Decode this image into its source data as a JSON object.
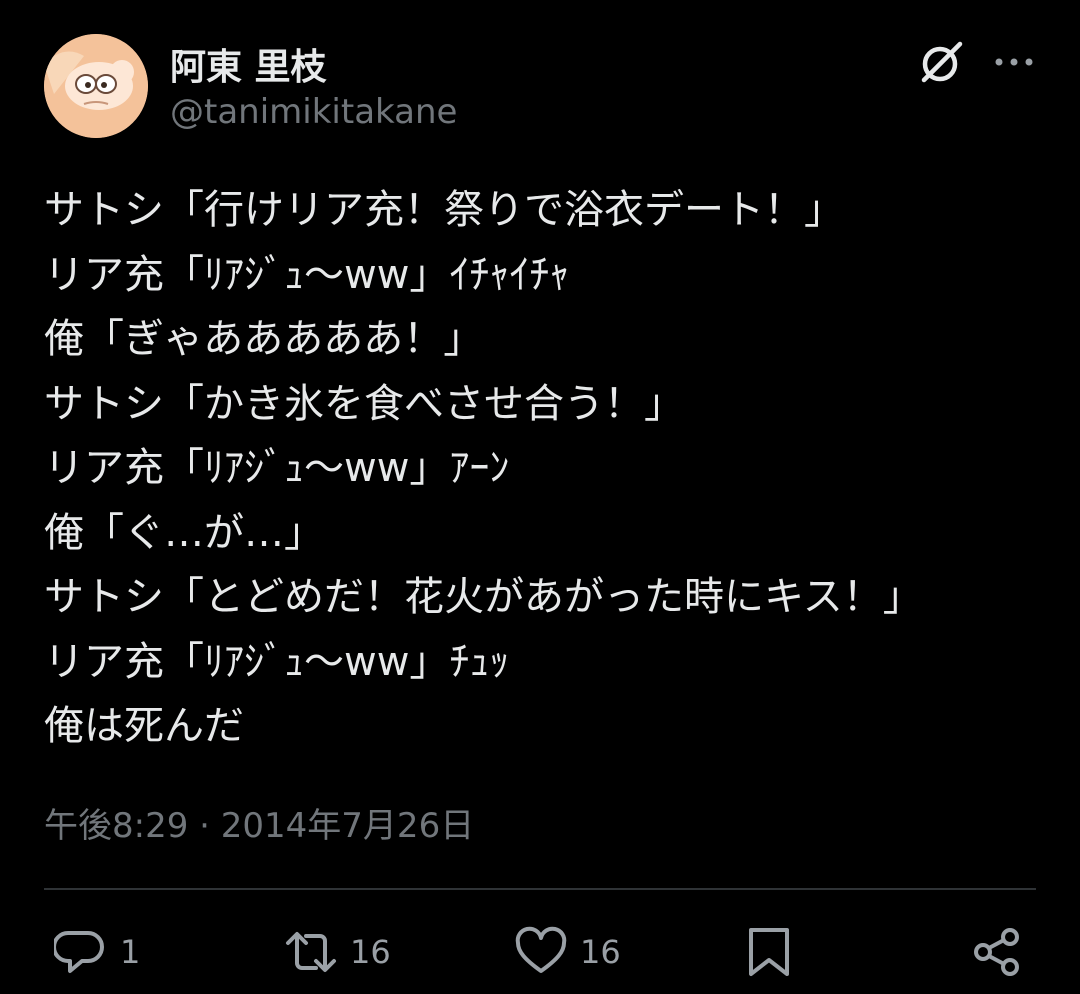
{
  "user": {
    "display_name": "阿東 里枝",
    "handle": "@tanimikitakane"
  },
  "header": {
    "grok_icon": "grok-icon",
    "more_icon": "more-dots-icon"
  },
  "tweet": {
    "lines": [
      "サトシ「行けリア充！祭りで浴衣デート！」",
      "リア充「ﾘｱｼﾞｭ〜ww」ｲﾁｬｲﾁｬ",
      "俺「ぎゃあああああ！」",
      "サトシ「かき氷を食べさせ合う！」",
      "リア充「ﾘｱｼﾞｭ〜ww」ｱｰﾝ",
      "俺「ぐ…が…」",
      "サトシ「とどめだ！花火があがった時にキス！」",
      "リア充「ﾘｱｼﾞｭ〜ww」ﾁｭｯ",
      "俺は死んだ"
    ],
    "timestamp": "午後8:29 · 2014年7月26日"
  },
  "actions": {
    "reply": {
      "icon": "reply-icon",
      "count": "1"
    },
    "retweet": {
      "icon": "retweet-icon",
      "count": "16"
    },
    "like": {
      "icon": "heart-icon",
      "count": "16"
    },
    "bookmark": {
      "icon": "bookmark-icon"
    },
    "share": {
      "icon": "share-icon"
    }
  },
  "colors": {
    "background": "#000000",
    "text_primary": "#e7e9ea",
    "text_secondary": "#71767b",
    "divider": "#2f3336",
    "avatar_bg": "#f4c29a"
  }
}
